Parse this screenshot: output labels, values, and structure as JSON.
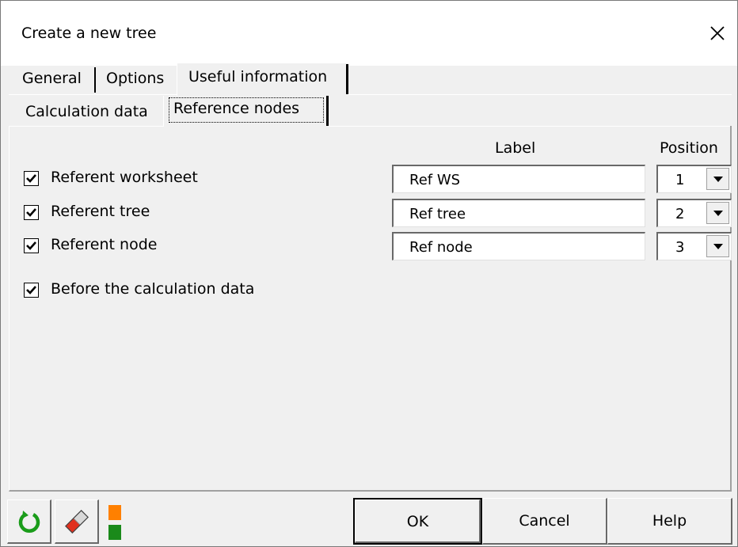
{
  "window": {
    "title": "Create a new tree"
  },
  "tabs_main": [
    {
      "label": "General"
    },
    {
      "label": "Options"
    },
    {
      "label": "Useful information"
    }
  ],
  "tabs_sub": [
    {
      "label": "Calculation data"
    },
    {
      "label": "Reference nodes"
    }
  ],
  "columns": {
    "label_header": "Label",
    "position_header": "Position"
  },
  "rows": [
    {
      "checkbox_label": "Referent worksheet",
      "checked": true,
      "field_value": "Ref WS",
      "position": "1"
    },
    {
      "checkbox_label": "Referent tree",
      "checked": true,
      "field_value": "Ref tree",
      "position": "2"
    },
    {
      "checkbox_label": "Referent node",
      "checked": true,
      "field_value": "Ref node",
      "position": "3"
    }
  ],
  "before_calc": {
    "label": "Before the calculation data",
    "checked": true
  },
  "footer": {
    "ok_label": "OK",
    "cancel_label": "Cancel",
    "help_label": "Help",
    "icons": [
      "refresh-icon",
      "eraser-icon",
      "orange-square-icon",
      "green-square-icon"
    ]
  },
  "colors": {
    "refresh": "#1a9c1a",
    "eraser": "#e0301e",
    "orange": "#ff8000",
    "green": "#1a8a1a"
  }
}
